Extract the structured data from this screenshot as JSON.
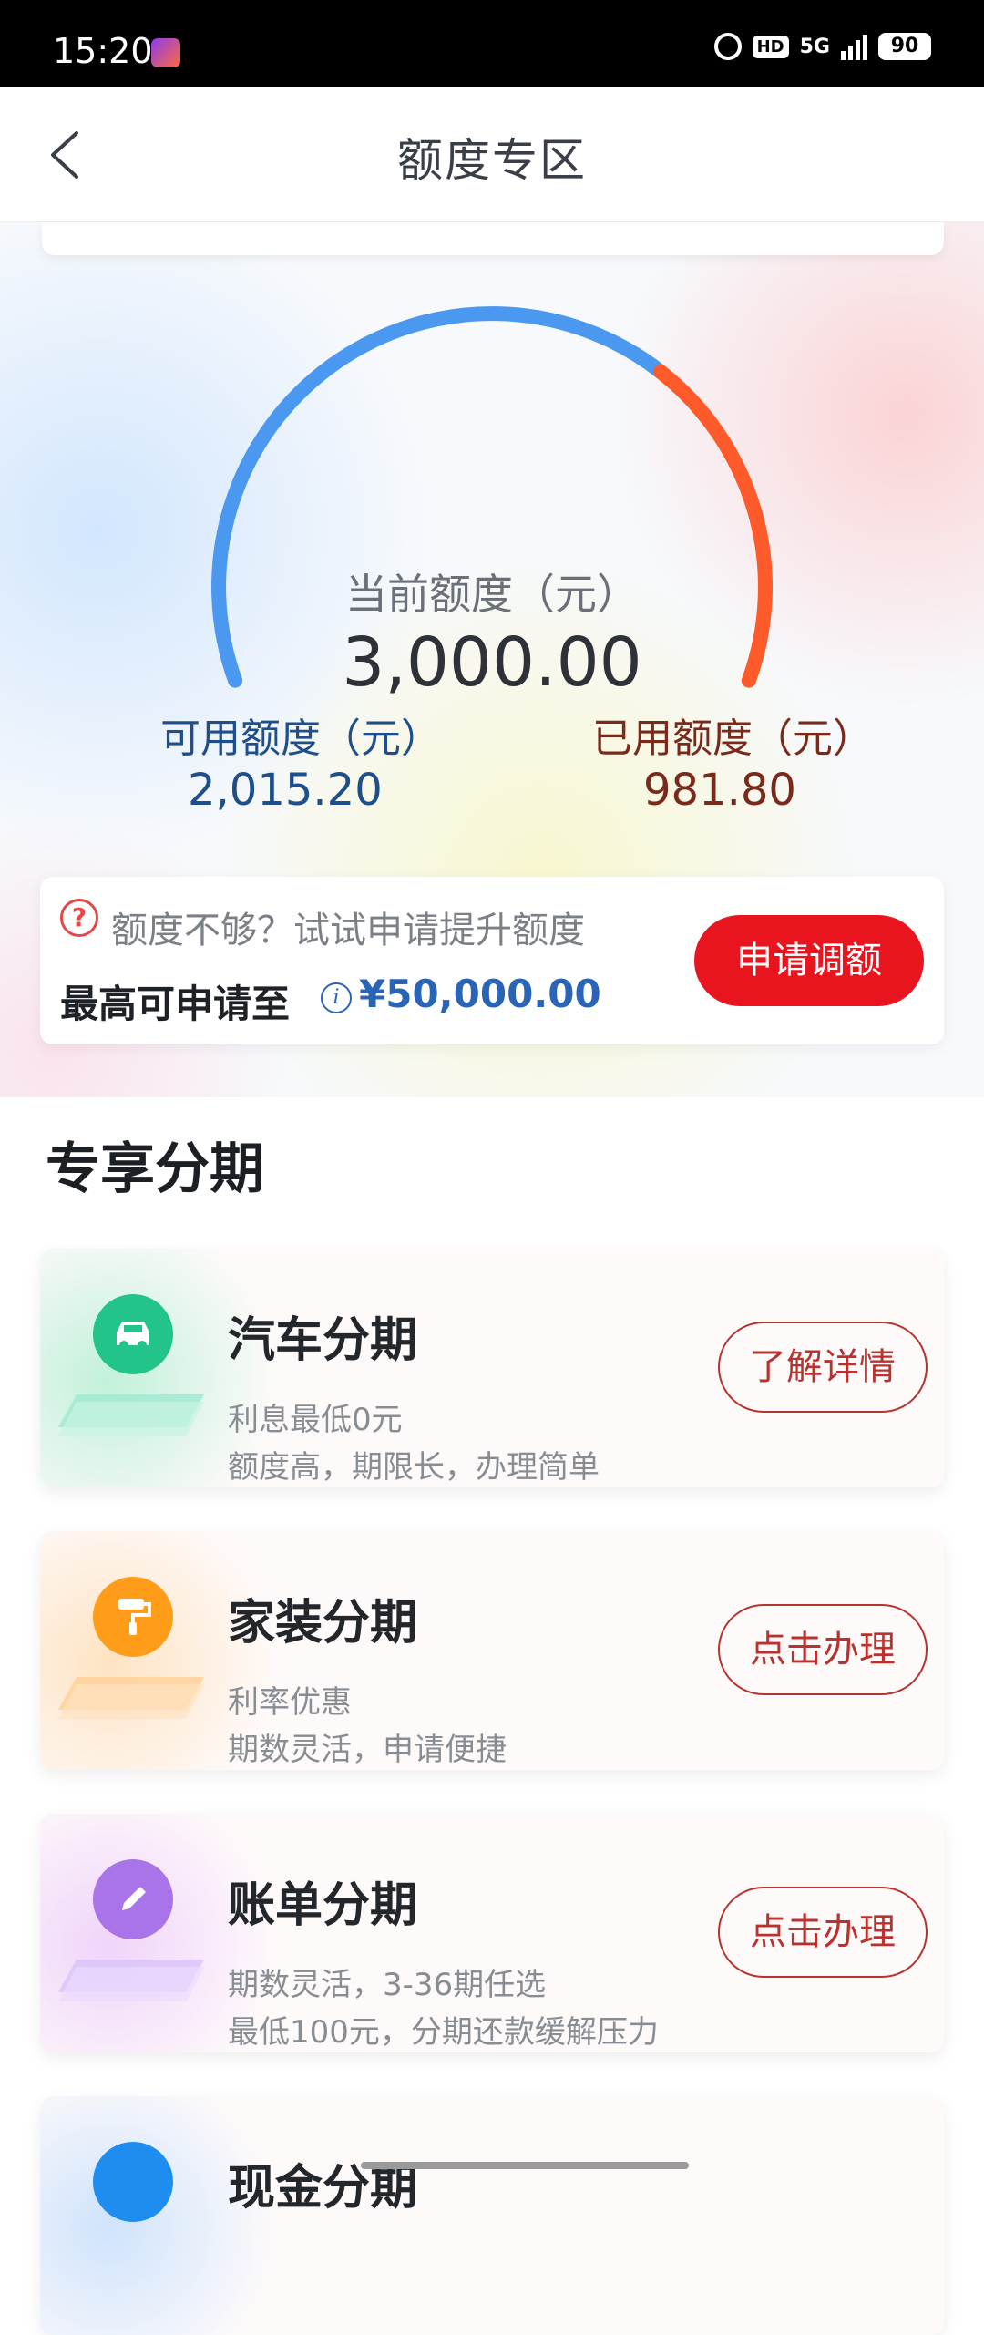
{
  "status_bar": {
    "time": "15:20",
    "network": "5G",
    "hd_label": "HD",
    "battery": "90"
  },
  "nav": {
    "title": "额度专区"
  },
  "credit": {
    "current_label": "当前额度（元）",
    "current_value": "3,000.00",
    "available_label": "可用额度（元）",
    "available_value": "2,015.20",
    "used_label": "已用额度（元）",
    "used_value": "981.80",
    "used_fraction": 0.327,
    "colors": {
      "available": "#4a98f0",
      "used": "#ff5a2a"
    }
  },
  "quota": {
    "tip": "额度不够？试试申请提升额度",
    "max_label": "最高可申请至",
    "max_value": "¥50,000.00",
    "apply_button": "申请调额"
  },
  "section": {
    "title": "专享分期"
  },
  "loans": [
    {
      "name": "汽车分期",
      "desc1": "利息最低0元",
      "desc2": "额度高，期限长，办理简单",
      "action": "了解详情",
      "icon": "car-icon",
      "color": "#22c48a"
    },
    {
      "name": "家装分期",
      "desc1": "利率优惠",
      "desc2": "期数灵活，申请便捷",
      "action": "点击办理",
      "icon": "paint-roller-icon",
      "color": "#ff9c1a"
    },
    {
      "name": "账单分期",
      "desc1": "期数灵活，3-36期任选",
      "desc2": "最低100元，分期还款缓解压力",
      "action": "点击办理",
      "icon": "pencil-icon",
      "color": "#a874e8"
    },
    {
      "name": "现金分期",
      "desc1": "",
      "desc2": "",
      "action": "",
      "icon": "cash-icon",
      "color": "#1f8df0"
    }
  ]
}
